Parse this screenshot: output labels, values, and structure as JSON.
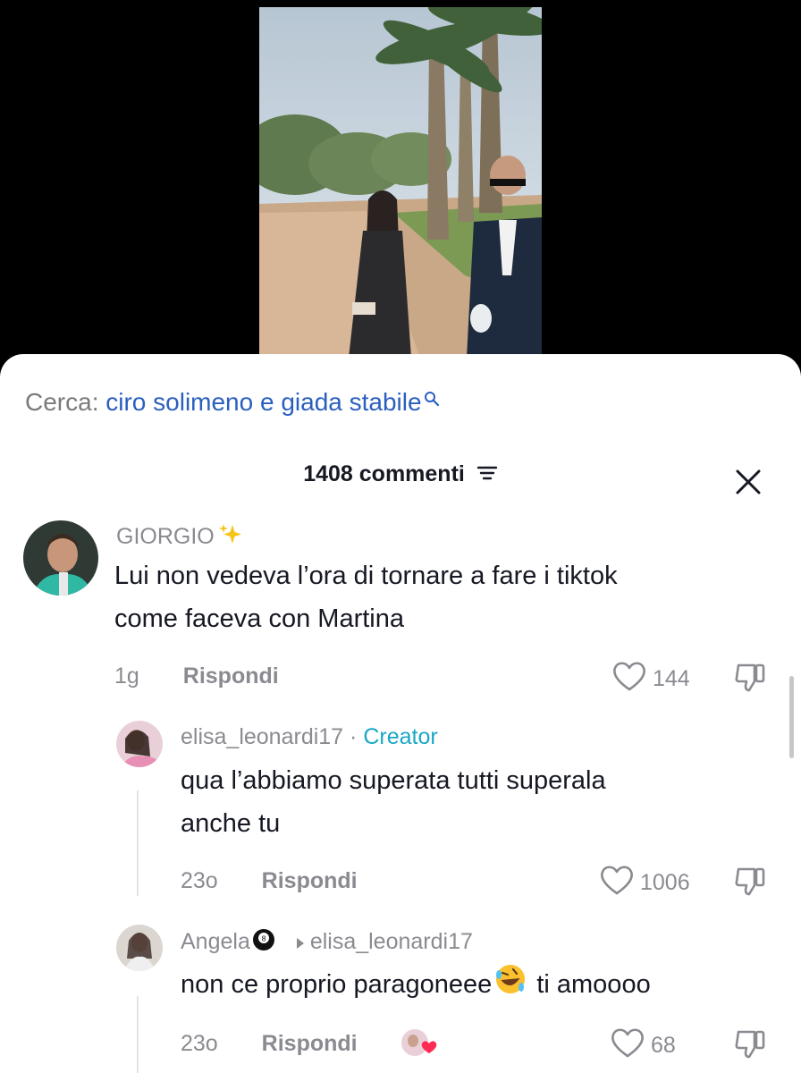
{
  "search": {
    "label": "Cerca:",
    "query": "ciro solimeno e giada stabile"
  },
  "header": {
    "count_label": "1408 commenti"
  },
  "comments": [
    {
      "username": "GIORGIO",
      "text_lines": [
        "Lui non vedeva l’ora di tornare a fare i tiktok",
        "come faceva con Martina"
      ],
      "time": "1g",
      "reply": "Rispondi",
      "likes": "144"
    },
    {
      "username": "elisa_leonardi17",
      "badge_sep": "·",
      "badge": "Creator",
      "text_lines": [
        "qua l’abbiamo superata tutti superala",
        "anche tu"
      ],
      "time": "23o",
      "reply": "Rispondi",
      "likes": "1006"
    },
    {
      "username": "Angela",
      "reply_to": "elisa_leonardi17",
      "text_pre": "non ce proprio paragoneee",
      "text_post": " ti amoooo",
      "time": "23o",
      "reply": "Rispondi",
      "likes": "68"
    }
  ],
  "icons": {
    "sparkle": "sparkles-icon",
    "search": "search-icon",
    "sort": "sort-icon",
    "close": "close-icon",
    "heart": "heart-icon",
    "dislike": "thumbs-down-icon",
    "emoji": "rofl-emoji",
    "eightball": "eight-ball-emoji"
  },
  "colors": {
    "creator": "#1aa7c5",
    "search_query": "#2b5fbf",
    "meta": "#8a8b91"
  }
}
